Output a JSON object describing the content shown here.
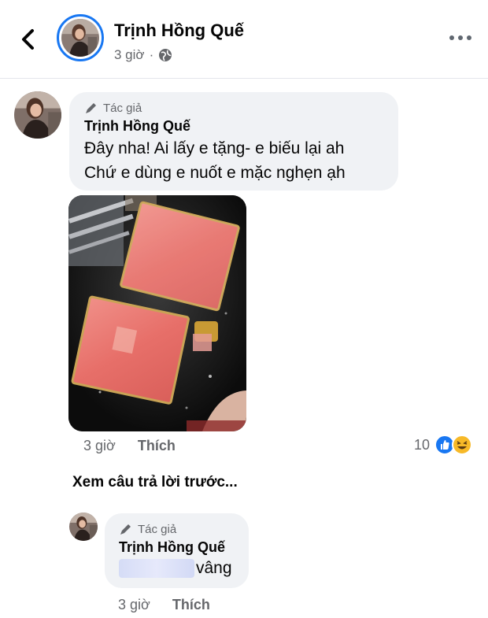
{
  "header": {
    "name": "Trịnh Hồng Quế",
    "time": "3 giờ",
    "separator": "·"
  },
  "comment": {
    "author_tag": "Tác giả",
    "name": "Trịnh Hồng Quế",
    "lines": [
      "Đây nha! Ai lấy e tặng- e biếu lại ah",
      "Chứ e dùng e nuốt e mặc nghẹn ạh"
    ],
    "time": "3 giờ",
    "like_label": "Thích",
    "reaction_count": "10"
  },
  "view_previous": "Xem câu trả lời trước...",
  "reply": {
    "author_tag": "Tác giả",
    "name": "Trịnh Hồng Quế",
    "text": "vâng",
    "time": "3 giờ",
    "like_label": "Thích"
  },
  "colors": {
    "accent": "#1877f2",
    "bubble": "#f0f2f5",
    "meta": "#65676b",
    "haha": "#f7b928"
  },
  "icons": [
    "back-chevron-icon",
    "globe-icon",
    "more-icon",
    "pencil-icon",
    "like-reaction-icon",
    "haha-reaction-icon"
  ]
}
